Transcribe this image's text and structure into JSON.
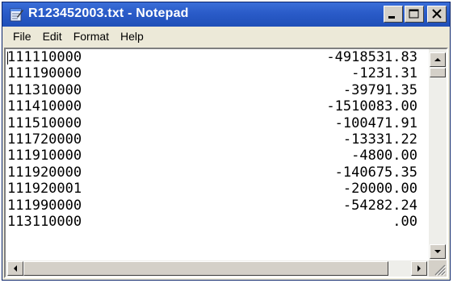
{
  "window": {
    "title": "R123452003.txt - Notepad"
  },
  "menu": [
    {
      "label": "File"
    },
    {
      "label": "Edit"
    },
    {
      "label": "Format"
    },
    {
      "label": "Help"
    }
  ],
  "rows": [
    {
      "code": "111110000",
      "amount": "-4918531.83"
    },
    {
      "code": "111190000",
      "amount": "-1231.31"
    },
    {
      "code": "111310000",
      "amount": "-39791.35"
    },
    {
      "code": "111410000",
      "amount": "-1510083.00"
    },
    {
      "code": "111510000",
      "amount": "-100471.91"
    },
    {
      "code": "111720000",
      "amount": "-13331.22"
    },
    {
      "code": "111910000",
      "amount": "-4800.00"
    },
    {
      "code": "111920000",
      "amount": "-140675.35"
    },
    {
      "code": "111920001",
      "amount": "-20000.00"
    },
    {
      "code": "111990000",
      "amount": "-54282.24"
    },
    {
      "code": "113110000",
      "amount": ".00"
    }
  ],
  "icons": {
    "app": "notepad-icon",
    "minimize": "minimize-icon",
    "maximize": "maximize-icon",
    "close": "close-icon"
  },
  "colors": {
    "titlebar": "#2a5bc8",
    "title_text": "#ffffff",
    "chrome": "#ece9d8"
  }
}
